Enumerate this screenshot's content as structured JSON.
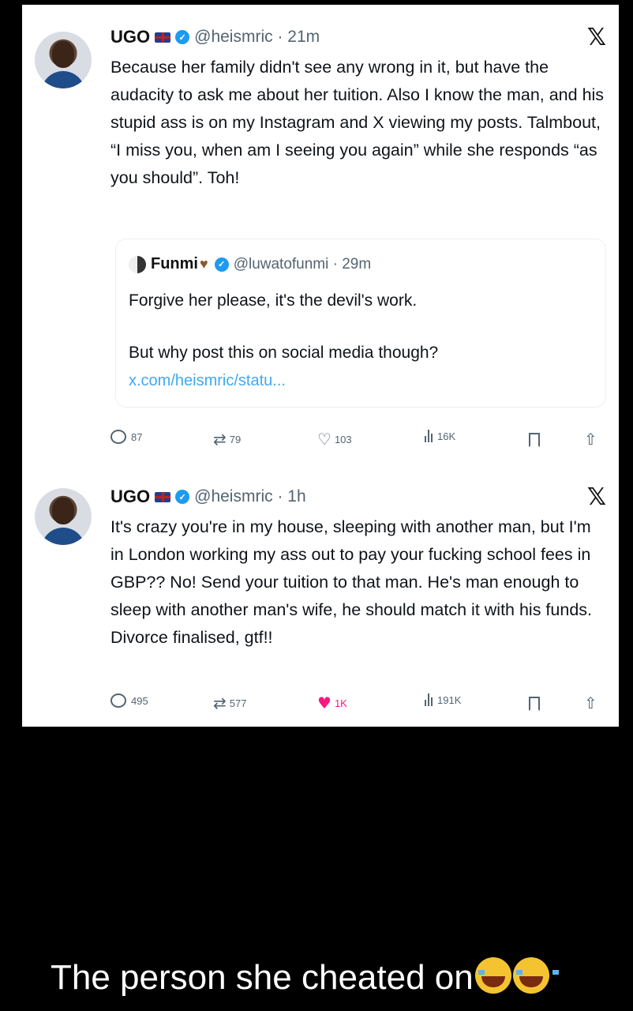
{
  "tweets": [
    {
      "name": "UGO",
      "handle_time": "@heismric · 21m",
      "text": "Because her family didn't see any wrong in it, but have the audacity to ask me about her tuition. Also I know the man, and his stupid ass is on my Instagram and X viewing my posts. Talmbout, “I miss you, when am I seeing you again” while she responds “as you should”. Toh!",
      "quote": {
        "name": "Funmi",
        "handle_time": "@luwatofunmi · 29m",
        "line1": "Forgive her please, it's the devil's work.",
        "line2": "But why post this on social media though?",
        "link": "x.com/heismric/statu..."
      },
      "actions": {
        "replies": "87",
        "reposts": "79",
        "likes": "103",
        "views": "16K"
      }
    },
    {
      "name": "UGO",
      "handle_time": "@heismric · 1h",
      "text": "It's crazy you're in my house, sleeping with another man, but I'm in London working my ass out to pay your fucking school fees in GBP?? No! Send your tuition to that man. He's man enough to sleep with another man's wife, he should match it with his funds. Divorce finalised, gtf!!",
      "actions": {
        "replies": "495",
        "reposts": "577",
        "likes": "1K",
        "views": "191K"
      }
    }
  ],
  "icons": {
    "verified": "verified-badge-icon",
    "flag": "uk-flag-icon",
    "x": "x-logo-icon",
    "reply": "reply-icon",
    "repost": "repost-icon",
    "like": "heart-icon",
    "views": "views-icon",
    "bookmark": "bookmark-icon",
    "share": "share-icon"
  },
  "colors": {
    "accent": "#1d9bf0",
    "like_active": "#f91880",
    "muted": "#536471"
  },
  "caption": "The person she cheated on"
}
